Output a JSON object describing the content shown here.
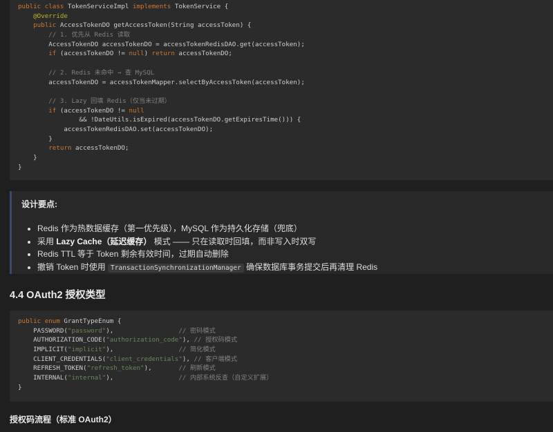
{
  "code_block_1": {
    "lines": [
      [
        {
          "t": "public class ",
          "c": "kw"
        },
        {
          "t": "TokenServiceImpl ",
          "c": "plain"
        },
        {
          "t": "implements ",
          "c": "kw"
        },
        {
          "t": "TokenService {",
          "c": "plain"
        }
      ],
      [
        {
          "t": "    ",
          "c": "plain"
        },
        {
          "t": "@Override",
          "c": "ann"
        }
      ],
      [
        {
          "t": "    ",
          "c": "plain"
        },
        {
          "t": "public ",
          "c": "kw"
        },
        {
          "t": "AccessTokenDO getAccessToken(String accessToken) {",
          "c": "plain"
        }
      ],
      [
        {
          "t": "        // 1. 优先从 Redis 读取",
          "c": "cmt"
        }
      ],
      [
        {
          "t": "        AccessTokenDO accessTokenDO = accessTokenRedisDAO.get(accessToken);",
          "c": "plain"
        }
      ],
      [
        {
          "t": "        ",
          "c": "plain"
        },
        {
          "t": "if ",
          "c": "kw"
        },
        {
          "t": "(accessTokenDO != ",
          "c": "plain"
        },
        {
          "t": "null",
          "c": "kw"
        },
        {
          "t": ") ",
          "c": "plain"
        },
        {
          "t": "return ",
          "c": "kw"
        },
        {
          "t": "accessTokenDO;",
          "c": "plain"
        }
      ],
      [
        {
          "t": "",
          "c": "plain"
        }
      ],
      [
        {
          "t": "        // 2. Redis 未命中 → 查 MySQL",
          "c": "cmt"
        }
      ],
      [
        {
          "t": "        accessTokenDO = accessTokenMapper.selectByAccessToken(accessToken);",
          "c": "plain"
        }
      ],
      [
        {
          "t": "",
          "c": "plain"
        }
      ],
      [
        {
          "t": "        // 3. Lazy 回填 Redis（仅当未过期）",
          "c": "cmt"
        }
      ],
      [
        {
          "t": "        ",
          "c": "plain"
        },
        {
          "t": "if ",
          "c": "kw"
        },
        {
          "t": "(accessTokenDO != ",
          "c": "plain"
        },
        {
          "t": "null",
          "c": "kw"
        }
      ],
      [
        {
          "t": "                && !DateUtils.isExpired(accessTokenDO.getExpiresTime())) {",
          "c": "plain"
        }
      ],
      [
        {
          "t": "            accessTokenRedisDAO.set(accessTokenDO);",
          "c": "plain"
        }
      ],
      [
        {
          "t": "        }",
          "c": "plain"
        }
      ],
      [
        {
          "t": "        ",
          "c": "plain"
        },
        {
          "t": "return ",
          "c": "kw"
        },
        {
          "t": "accessTokenDO;",
          "c": "plain"
        }
      ],
      [
        {
          "t": "    }",
          "c": "plain"
        }
      ],
      [
        {
          "t": "}",
          "c": "plain"
        }
      ]
    ]
  },
  "callout": {
    "title": "设计要点:",
    "items": [
      [
        {
          "t": "Redis 作为热数据缓存（第一优先级），MySQL 作为持久化存储（兜底）",
          "s": "text"
        }
      ],
      [
        {
          "t": "采用 ",
          "s": "text"
        },
        {
          "t": "Lazy Cache（延迟缓存）",
          "s": "bold"
        },
        {
          "t": " 模式 —— 只在读取时回填，而非写入时双写",
          "s": "text"
        }
      ],
      [
        {
          "t": "Redis TTL 等于 Token 剩余有效时间，过期自动删除",
          "s": "text"
        }
      ],
      [
        {
          "t": "撤销 Token 时使用 ",
          "s": "text"
        },
        {
          "t": "TransactionSynchronizationManager",
          "s": "code"
        },
        {
          "t": " 确保数据库事务提交后再清理 Redis",
          "s": "text"
        }
      ]
    ]
  },
  "section_heading": "4.4 OAuth2 授权类型",
  "code_block_2": {
    "lines": [
      [
        {
          "t": "public enum ",
          "c": "kw"
        },
        {
          "t": "GrantTypeEnum {",
          "c": "plain"
        }
      ],
      [
        {
          "t": "    PASSWORD(",
          "c": "plain"
        },
        {
          "t": "\"password\"",
          "c": "str"
        },
        {
          "t": "),                 ",
          "c": "plain"
        },
        {
          "t": "// 密码模式",
          "c": "cmt"
        }
      ],
      [
        {
          "t": "    AUTHORIZATION_CODE(",
          "c": "plain"
        },
        {
          "t": "\"authorization_code\"",
          "c": "str"
        },
        {
          "t": "), ",
          "c": "plain"
        },
        {
          "t": "// 授权码模式",
          "c": "cmt"
        }
      ],
      [
        {
          "t": "    IMPLICIT(",
          "c": "plain"
        },
        {
          "t": "\"implicit\"",
          "c": "str"
        },
        {
          "t": "),                 ",
          "c": "plain"
        },
        {
          "t": "// 简化模式",
          "c": "cmt"
        }
      ],
      [
        {
          "t": "    CLIENT_CREDENTIALS(",
          "c": "plain"
        },
        {
          "t": "\"client_credentials\"",
          "c": "str"
        },
        {
          "t": "), ",
          "c": "plain"
        },
        {
          "t": "// 客户端模式",
          "c": "cmt"
        }
      ],
      [
        {
          "t": "    REFRESH_TOKEN(",
          "c": "plain"
        },
        {
          "t": "\"refresh_token\"",
          "c": "str"
        },
        {
          "t": "),       ",
          "c": "plain"
        },
        {
          "t": "// 刷新模式",
          "c": "cmt"
        }
      ],
      [
        {
          "t": "    INTERNAL(",
          "c": "plain"
        },
        {
          "t": "\"internal\"",
          "c": "str"
        },
        {
          "t": "),                 ",
          "c": "plain"
        },
        {
          "t": "// 内部系统反查（自定义扩展）",
          "c": "cmt"
        }
      ],
      [
        {
          "t": "}",
          "c": "plain"
        }
      ]
    ]
  },
  "sub_heading": "授权码流程（标准 OAuth2）",
  "colors": {
    "background": "#1f1f1f",
    "code_background": "#2b2b2b",
    "keyword": "#cc7832",
    "string": "#6a8759",
    "comment": "#808080",
    "annotation": "#bbb529",
    "callout_border": "#3b4a6b"
  }
}
